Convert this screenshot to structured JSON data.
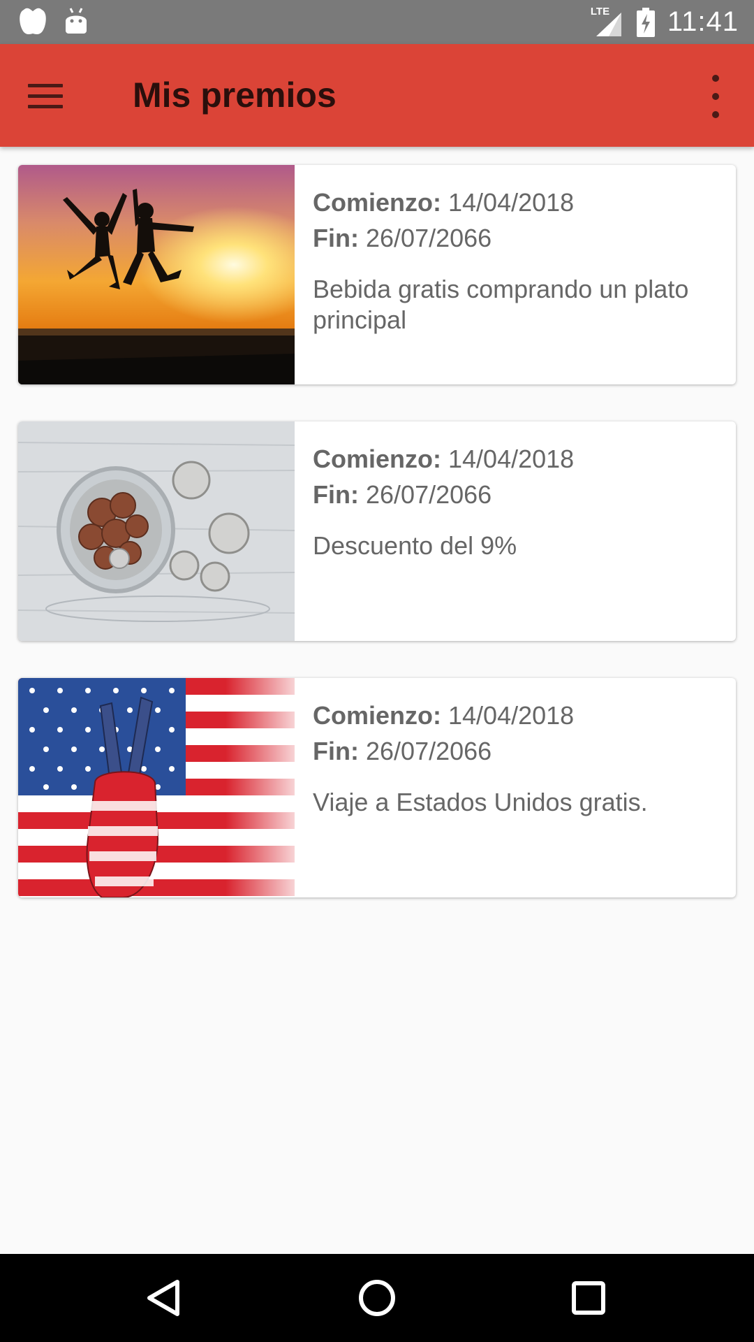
{
  "status_bar": {
    "network_label": "LTE",
    "time": "11:41"
  },
  "app_bar": {
    "title": "Mis premios",
    "menu_icon": "hamburger-menu-icon",
    "overflow_icon": "more-vert-icon",
    "background_color": "#db4437"
  },
  "rewards": [
    {
      "start_label": "Comienzo:",
      "start_date": "14/04/2018",
      "end_label": "Fin:",
      "end_date": "26/07/2066",
      "description": "Bebida gratis comprando un plato principal",
      "image": "sunset-jumping-people-image"
    },
    {
      "start_label": "Comienzo:",
      "start_date": "14/04/2018",
      "end_label": "Fin:",
      "end_date": "26/07/2066",
      "description": "Descuento del 9%",
      "image": "coin-jar-image"
    },
    {
      "start_label": "Comienzo:",
      "start_date": "14/04/2018",
      "end_label": "Fin:",
      "end_date": "26/07/2066",
      "description": "Viaje a Estados Unidos gratis.",
      "image": "usa-flag-peace-hand-image"
    }
  ],
  "nav_bar": {
    "back_icon": "back-triangle-icon",
    "home_icon": "home-circle-icon",
    "recents_icon": "recents-square-icon"
  }
}
